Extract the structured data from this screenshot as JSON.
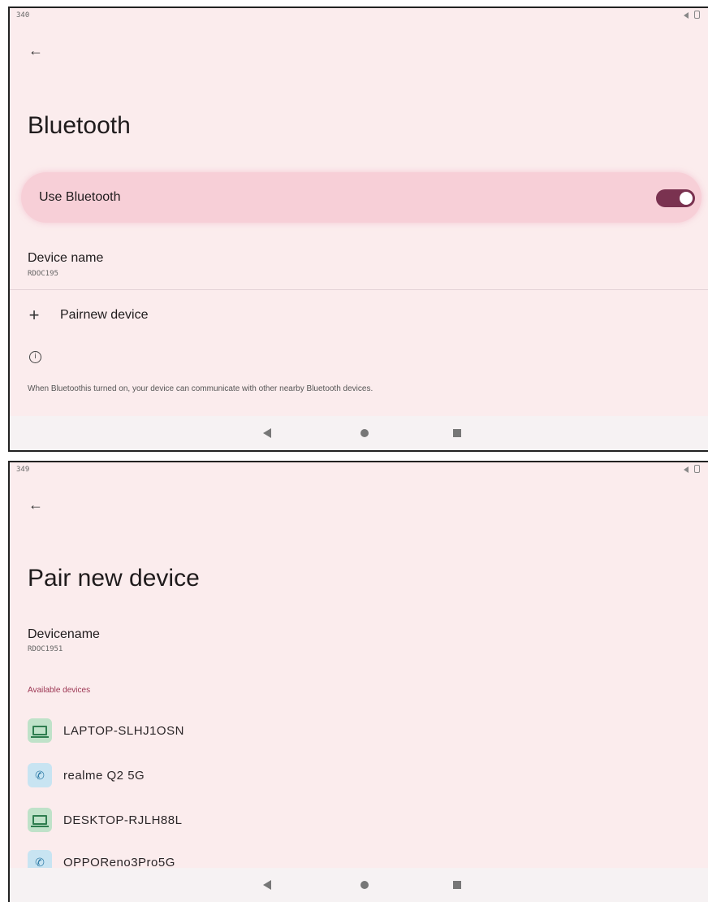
{
  "screen1": {
    "status_time": "340",
    "title": "Bluetooth",
    "use_bluetooth_label": "Use Bluetooth",
    "toggle_state": "on",
    "device_name_label": "Device name",
    "device_name_value": "RDOC195",
    "pair_new_label": "Pairnew device",
    "info_text": "When Bluetoothis turned on, your device can communicate with other nearby Bluetooth devices."
  },
  "screen2": {
    "status_time": "349",
    "title": "Pair new device",
    "device_name_label": "Devicename",
    "device_name_value": "RDOC1951",
    "section_header": "Available devices",
    "devices": [
      {
        "name": "LAPTOP-SLHJ1OSN",
        "icon": "laptop-icon"
      },
      {
        "name": "realme Q2 5G",
        "icon": "phone-icon"
      },
      {
        "name": "DESKTOP-RJLH88L",
        "icon": "laptop-icon"
      },
      {
        "name": "OPPOReno3Pro5G",
        "icon": "phone-icon"
      }
    ]
  },
  "icons": {
    "back": "back-arrow-icon",
    "plus": "plus-icon",
    "info": "info-icon",
    "nav_back": "nav-back-icon",
    "nav_home": "nav-home-icon",
    "nav_recent": "nav-recent-icon"
  },
  "colors": {
    "background": "#fbeced",
    "card_highlight": "#f7cfd7",
    "toggle_on": "#7a3250",
    "section_header": "#9c3552",
    "laptop_icon_bg": "#bfe2c9",
    "phone_icon_bg": "#c8e4f2"
  }
}
